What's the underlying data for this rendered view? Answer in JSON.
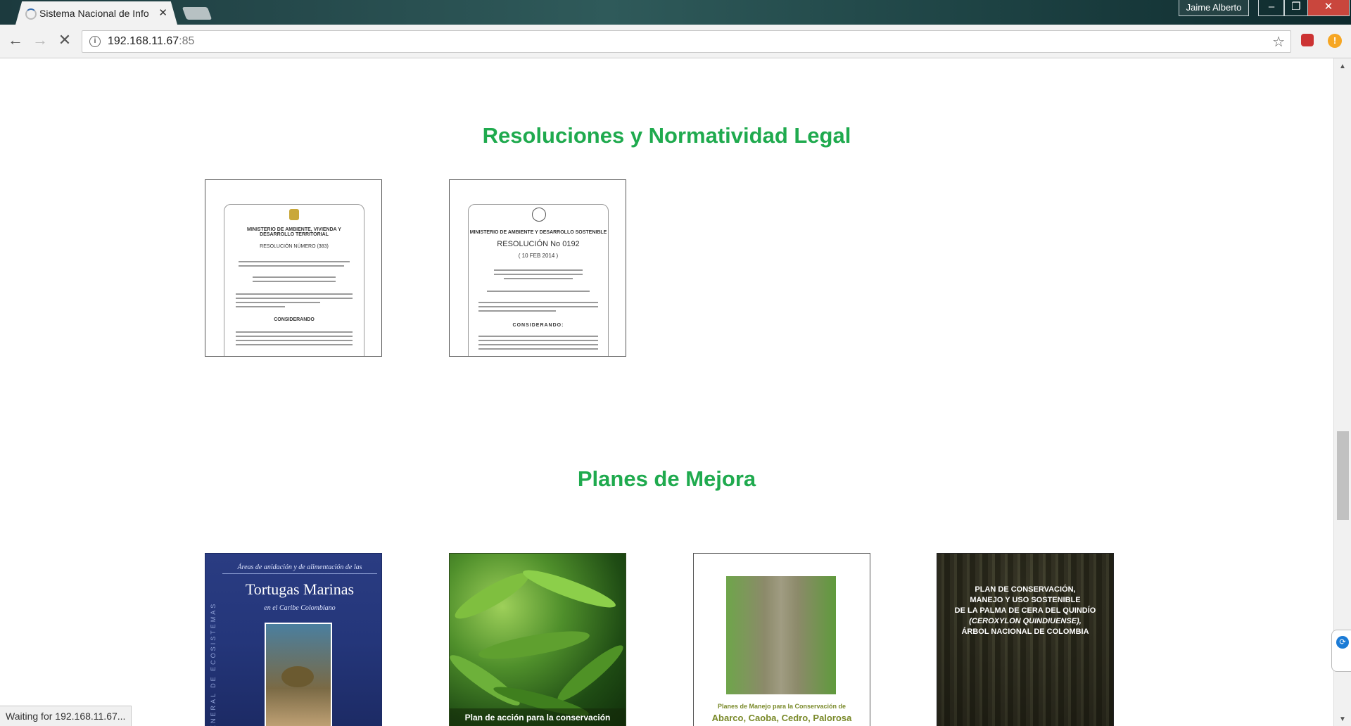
{
  "browser": {
    "tab_title": "Sistema Nacional de Info",
    "profile_name": "Jaime Alberto",
    "url_host": "192.168.11.67",
    "url_port": ":85",
    "status_text": "Waiting for 192.168.11.67..."
  },
  "sections": {
    "resoluciones": {
      "title": "Resoluciones y Normatividad Legal",
      "docs": [
        {
          "header": "MINISTERIO DE AMBIENTE, VIVIENDA Y DESARROLLO TERRITORIAL",
          "number": "RESOLUCIÓN NÚMERO (383)",
          "section": "CONSIDERANDO"
        },
        {
          "header": "MINISTERIO DE AMBIENTE Y DESARROLLO SOSTENIBLE",
          "number": "RESOLUCIÓN No 0192",
          "date": "( 10 FEB 2014 )",
          "section": "CONSIDERANDO:"
        }
      ]
    },
    "planes": {
      "title": "Planes de Mejora",
      "covers": [
        {
          "small_title": "Áreas de anidación y de alimentación de las",
          "title": "Tortugas Marinas",
          "subtitle": "en el Caribe Colombiano",
          "side_text": "GENERAL DE ECOSISTEMAS"
        },
        {
          "bottom_text": "Plan de acción para la conservación"
        },
        {
          "caption": "Planes de Manejo para la Conservación de",
          "title": "Abarco, Caoba, Cedro, Palorosa"
        },
        {
          "title_lines": [
            "PLAN DE CONSERVACIÓN,",
            "MANEJO Y USO SOSTENIBLE",
            "DE LA PALMA DE CERA DEL QUINDÍO",
            "(CEROXYLON QUINDIUENSE),",
            "ÁRBOL NACIONAL DE COLOMBIA"
          ]
        }
      ]
    }
  },
  "colors": {
    "section_title": "#1faa4e",
    "titlebar": "#1c3a3e"
  }
}
